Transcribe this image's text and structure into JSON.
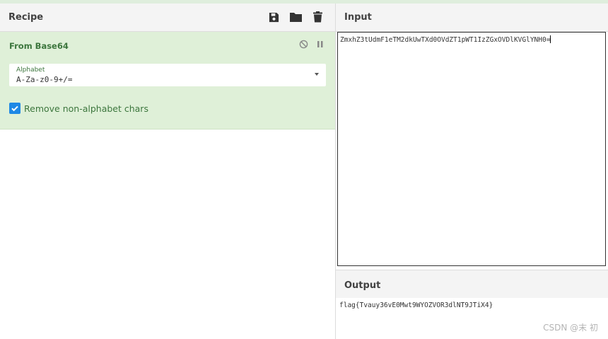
{
  "recipe": {
    "title": "Recipe",
    "icons": [
      "save-icon",
      "folder-icon",
      "trash-icon"
    ],
    "operation": {
      "name": "From Base64",
      "controls": [
        "disable-icon",
        "pause-icon"
      ],
      "alphabet_label": "Alphabet",
      "alphabet_value": "A-Za-z0-9+/=",
      "checkbox_label": "Remove non-alphabet chars",
      "checkbox_checked": true
    }
  },
  "input": {
    "title": "Input",
    "value": "ZmxhZ3tUdmF1eTM2dkUwTXd0OVdZT1pWT1IzZGxOVDlKVGlYNH0="
  },
  "output": {
    "title": "Output",
    "value": "flag{Tvauy36vE0Mwt9WYOZVOR3dlNT9JTiX4}"
  },
  "watermark": "CSDN @末 初",
  "colors": {
    "op_bg": "#dff0d8",
    "op_text": "#3c763d",
    "checkbox": "#1e88e5",
    "header_bg": "#f4f4f4"
  }
}
